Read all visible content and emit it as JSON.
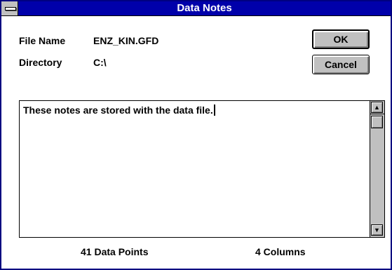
{
  "window": {
    "title": "Data Notes"
  },
  "fields": {
    "file_name_label": "File Name",
    "file_name_value": "ENZ_KIN.GFD",
    "directory_label": "Directory",
    "directory_value": "C:\\"
  },
  "buttons": {
    "ok": "OK",
    "cancel": "Cancel"
  },
  "notes": {
    "text": "These notes are stored with the data file."
  },
  "status": {
    "data_points": "41 Data Points",
    "columns": "4 Columns"
  },
  "icons": {
    "system_menu": "system-menu-icon",
    "scroll_up": "arrow-up-icon",
    "scroll_down": "arrow-down-icon"
  },
  "colors": {
    "title_bar": "#0000aa",
    "button_face": "#c0c0c0"
  }
}
